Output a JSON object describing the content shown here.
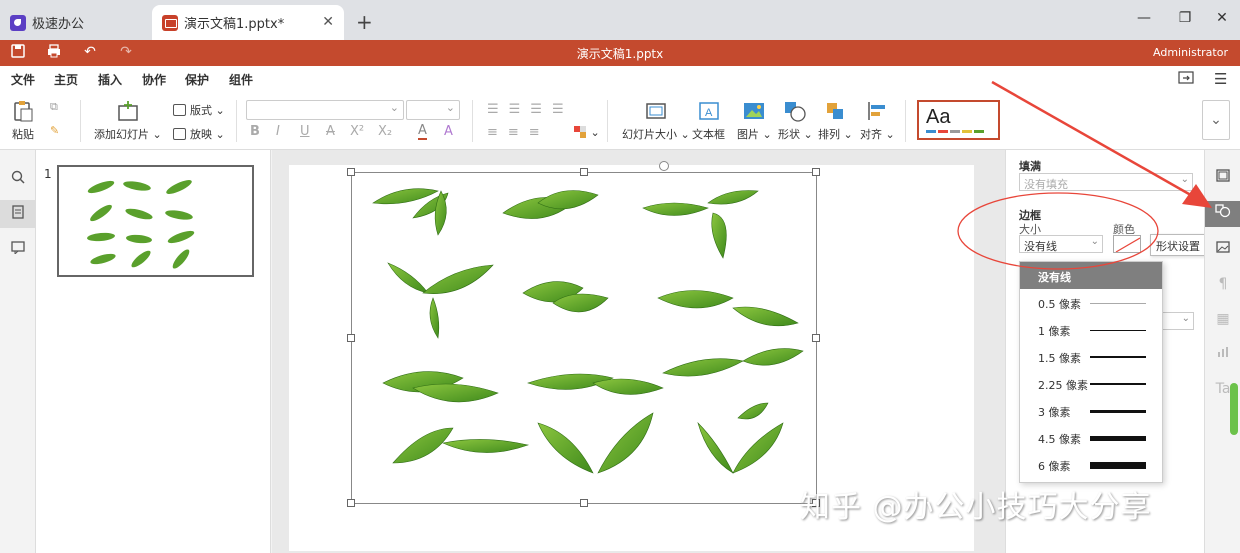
{
  "tabs": [
    {
      "label": "极速办公",
      "icon": "app-rocket-icon"
    },
    {
      "label": "演示文稿1.pptx*",
      "icon": "presentation-icon"
    }
  ],
  "window": {
    "doc_title": "演示文稿1.pptx",
    "user": "Administrator"
  },
  "menu": [
    "文件",
    "主页",
    "插入",
    "协作",
    "保护",
    "组件"
  ],
  "ribbon": {
    "paste": "粘贴",
    "add_slide": "添加幻灯片",
    "layout": "版式",
    "play": "放映",
    "slide_size": "幻灯片大小",
    "textbox": "文本框",
    "picture": "图片",
    "shape": "形状",
    "arrange": "排列",
    "align": "对齐",
    "theme_label": "Aa",
    "format_buttons": [
      "B",
      "I",
      "U",
      "A",
      "X²",
      "X₂",
      "A",
      "A"
    ]
  },
  "thumbnails": {
    "slide_number": "1"
  },
  "props": {
    "fill_title": "填满",
    "fill_value": "没有填充",
    "border_title": "边框",
    "size_label": "大小",
    "color_label": "颜色",
    "size_value": "没有线",
    "tooltip": "形状设置"
  },
  "line_dropdown": {
    "header": "没有线",
    "items": [
      {
        "label": "0.5 像素",
        "width": 0.5
      },
      {
        "label": "1 像素",
        "width": 1
      },
      {
        "label": "1.5 像素",
        "width": 1.5
      },
      {
        "label": "2.25 像素",
        "width": 2.25
      },
      {
        "label": "3 像素",
        "width": 3
      },
      {
        "label": "4.5 像素",
        "width": 4.5
      },
      {
        "label": "6 像素",
        "width": 6
      }
    ]
  },
  "watermark": "知乎 @办公小技巧大分享",
  "colors": {
    "accent": "#c44a2e",
    "leaf": "#5aa02c",
    "annotation": "#e8463a"
  }
}
